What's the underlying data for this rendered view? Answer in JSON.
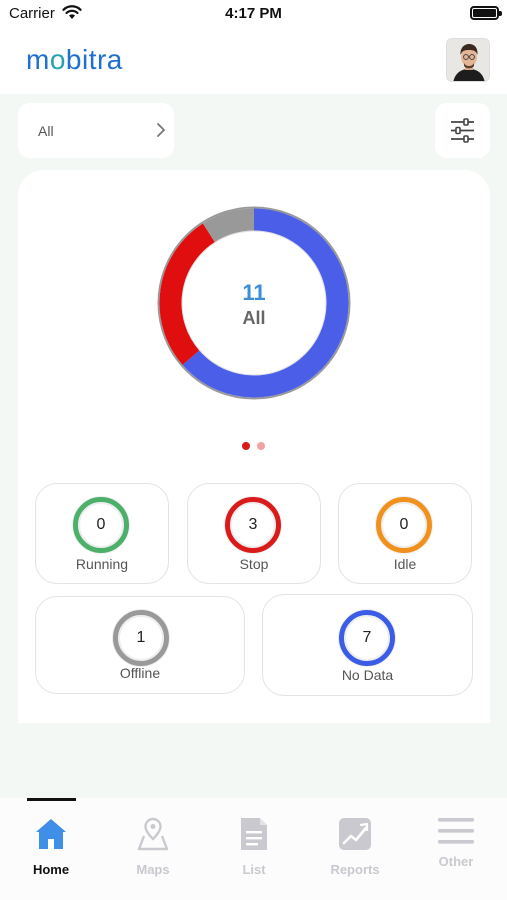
{
  "status_bar": {
    "carrier": "Carrier",
    "time": "4:17 PM"
  },
  "header": {
    "logo_prefix": "m",
    "logo_o": "o",
    "logo_suffix": "bitra",
    "avatar_icon": "user-avatar"
  },
  "filter": {
    "label": "All",
    "chevron_icon": "chevron-right-icon",
    "settings_icon": "sliders-icon"
  },
  "summary": {
    "total": "11",
    "total_label": "All",
    "segments": [
      {
        "name": "No Data",
        "value": 7,
        "color": "#4a5ee8"
      },
      {
        "name": "Stop",
        "value": 3,
        "color": "#e00e0e"
      },
      {
        "name": "Offline",
        "value": 1,
        "color": "#999999"
      }
    ],
    "page_count": 2,
    "active_page": 1
  },
  "stats": {
    "running": {
      "count": "0",
      "label": "Running",
      "color": "#4caf6a"
    },
    "stop": {
      "count": "3",
      "label": "Stop",
      "color": "#d91b1b"
    },
    "idle": {
      "count": "0",
      "label": "Idle",
      "color": "#f0911c"
    },
    "offline": {
      "count": "1",
      "label": "Offline",
      "color": "#999999"
    },
    "no_data": {
      "count": "7",
      "label": "No Data",
      "color": "#3c5be6"
    }
  },
  "nav": {
    "active": "Home",
    "items": [
      {
        "label": "Home",
        "icon": "home-icon"
      },
      {
        "label": "Maps",
        "icon": "map-pin-icon"
      },
      {
        "label": "List",
        "icon": "document-icon"
      },
      {
        "label": "Reports",
        "icon": "reports-icon"
      },
      {
        "label": "Other",
        "icon": "menu-icon"
      }
    ]
  },
  "colors": {
    "accent": "#1f6fd0",
    "background": "#f4f8f4",
    "card": "#ffffff"
  }
}
